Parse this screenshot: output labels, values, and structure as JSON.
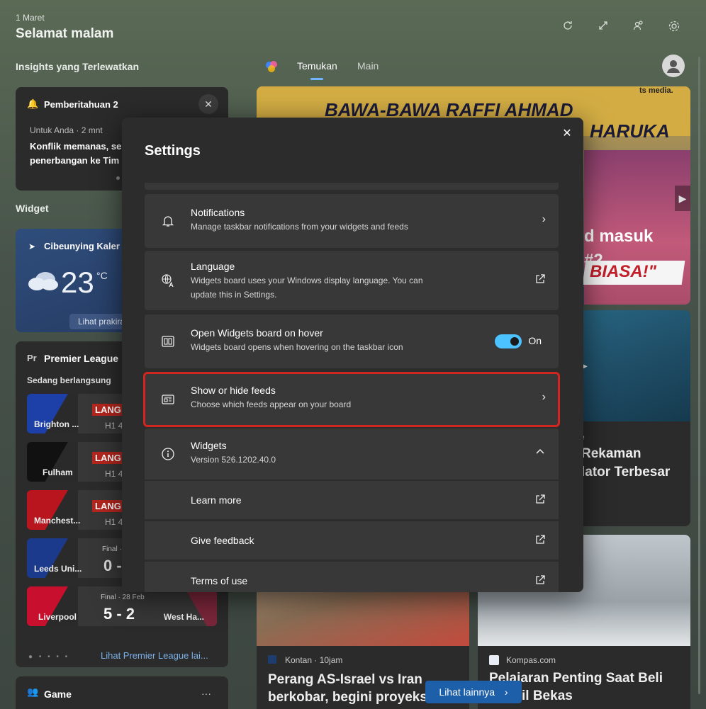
{
  "header": {
    "date": "1 Maret",
    "greeting": "Selamat malam",
    "icons": [
      "refresh-icon",
      "expand-icon",
      "people-icon",
      "gear-icon"
    ]
  },
  "insights": {
    "title": "Insights yang Terlewatkan",
    "card_title": "Pemberitahuan 2",
    "source": "Untuk Anda · 2 mnt",
    "headline": "Konflik memanas, se penerbangan ke Tim"
  },
  "widgets_section": "Widget",
  "weather": {
    "location": "Cibeunying Kaler",
    "temp": "23",
    "unit": "°C",
    "forecast_btn": "Lihat prakira"
  },
  "premier": {
    "prefix": "Pr",
    "title": "Premier League",
    "status": "Sedang berlangsung",
    "matches": [
      {
        "team": "Brighton ...",
        "badge": "LANG",
        "info": "H1 4"
      },
      {
        "team": "Fulham",
        "badge": "LANG",
        "info": "H1 4"
      },
      {
        "team": "Manchest...",
        "badge": "LANG",
        "info": "H1 4"
      },
      {
        "team": "Leeds Uni...",
        "final": "Final ·",
        "score": "0 -"
      },
      {
        "team": "Liverpool",
        "final": "Final · 28 Feb",
        "score": "5 - 2",
        "away": "West Ha..."
      }
    ],
    "more_link": "Lihat Premier League lai..."
  },
  "game": {
    "title": "Game",
    "menu": "···"
  },
  "feed": {
    "tabs": [
      "Temukan",
      "Main"
    ],
    "hero_text": "BAWA-BAWA RAFFI AHMAD",
    "hero_text2": "HARUKA",
    "hero_brand": "ts media.",
    "hero_overlay1": "d masuk",
    "hero_overlay2": "#2",
    "hero_overlay3": "BIASA!\"",
    "side_text1": "Rekaman",
    "side_text2": "lator Terbesar",
    "side_tag": "e",
    "bottom_left": {
      "source": "Kontan · 10jam",
      "headline": "Perang AS-Israel vs Iran berkobar, begini proyeks"
    },
    "bottom_right": {
      "source": "Kompas.com",
      "headline": "Pelajaran Penting Saat Beli",
      "headline2": "il Bekas"
    },
    "see_more": "Lihat lainnya"
  },
  "dialog": {
    "title": "Settings",
    "rows": {
      "notifications": {
        "title": "Notifications",
        "desc": "Manage taskbar notifications from your widgets and feeds"
      },
      "language": {
        "title": "Language",
        "desc1": "Widgets board uses your Windows display language. You can",
        "desc2": "update this in Settings."
      },
      "hover": {
        "title": "Open Widgets board on hover",
        "desc": "Widgets board opens when hovering on the taskbar icon",
        "state": "On"
      },
      "feeds": {
        "title": "Show or hide feeds",
        "desc": "Choose which feeds appear on your board"
      },
      "widgets": {
        "title": "Widgets",
        "desc": "Version 526.1202.40.0"
      },
      "learn": {
        "title": "Learn more"
      },
      "feedback": {
        "title": "Give feedback"
      },
      "terms": {
        "title": "Terms of use"
      }
    }
  }
}
